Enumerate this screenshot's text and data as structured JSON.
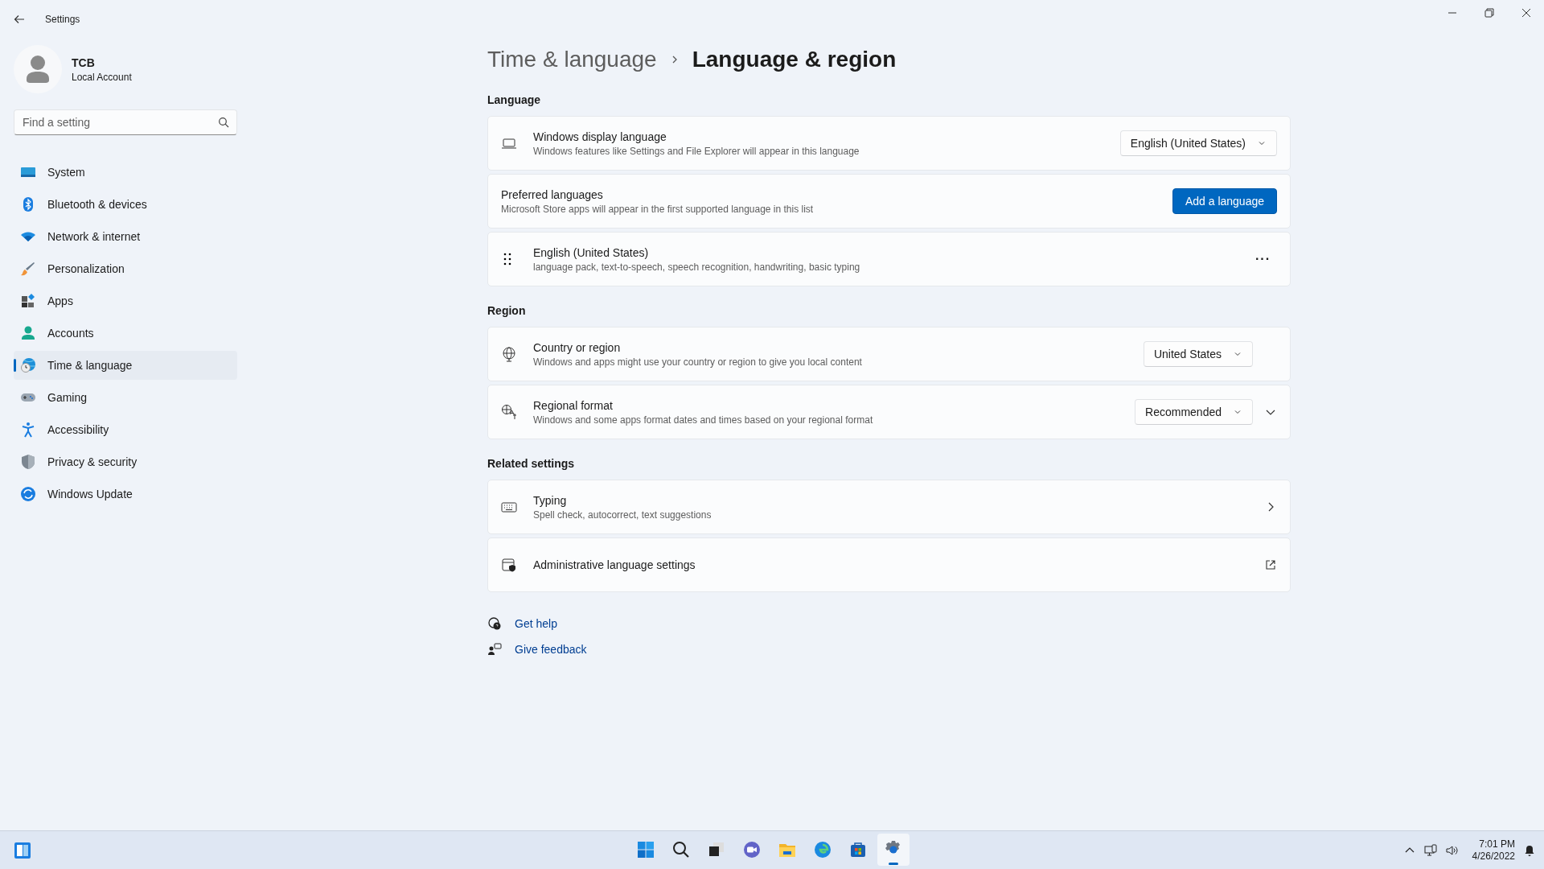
{
  "window": {
    "title": "Settings"
  },
  "user": {
    "name": "TCB",
    "account": "Local Account"
  },
  "search": {
    "placeholder": "Find a setting"
  },
  "nav": [
    {
      "label": "System",
      "selected": false
    },
    {
      "label": "Bluetooth & devices",
      "selected": false
    },
    {
      "label": "Network & internet",
      "selected": false
    },
    {
      "label": "Personalization",
      "selected": false
    },
    {
      "label": "Apps",
      "selected": false
    },
    {
      "label": "Accounts",
      "selected": false
    },
    {
      "label": "Time & language",
      "selected": true
    },
    {
      "label": "Gaming",
      "selected": false
    },
    {
      "label": "Accessibility",
      "selected": false
    },
    {
      "label": "Privacy & security",
      "selected": false
    },
    {
      "label": "Windows Update",
      "selected": false
    }
  ],
  "breadcrumb": {
    "parent": "Time & language",
    "current": "Language & region"
  },
  "sections": [
    {
      "heading": "Language",
      "cards": [
        {
          "kind": "dropdown",
          "title": "Windows display language",
          "description": "Windows features like Settings and File Explorer will appear in this language",
          "value": "English (United States)"
        },
        {
          "kind": "button",
          "title": "Preferred languages",
          "description": "Microsoft Store apps will appear in the first supported language in this list",
          "button": "Add a language"
        },
        {
          "kind": "reorder",
          "title": "English (United States)",
          "description": "language pack, text-to-speech, speech recognition, handwriting, basic typing",
          "more": "···"
        }
      ]
    },
    {
      "heading": "Region",
      "cards": [
        {
          "kind": "dropdown",
          "title": "Country or region",
          "description": "Windows and apps might use your country or region to give you local content",
          "value": "United States"
        },
        {
          "kind": "expand-dropdown",
          "title": "Regional format",
          "description": "Windows and some apps format dates and times based on your regional format",
          "value": "Recommended"
        }
      ]
    },
    {
      "heading": "Related settings",
      "cards": [
        {
          "kind": "link",
          "title": "Typing",
          "description": "Spell check, autocorrect, text suggestions"
        },
        {
          "kind": "external",
          "title": "Administrative language settings"
        }
      ]
    }
  ],
  "help_links": [
    {
      "label": "Get help"
    },
    {
      "label": "Give feedback"
    }
  ],
  "taskbar": {
    "apps": [
      {
        "selected": false
      },
      {
        "selected": false
      },
      {
        "selected": false
      },
      {
        "selected": false
      },
      {
        "selected": false
      },
      {
        "selected": false
      },
      {
        "selected": false
      },
      {
        "selected": true
      }
    ],
    "time": "7:01 PM",
    "date": "4/26/2022"
  }
}
